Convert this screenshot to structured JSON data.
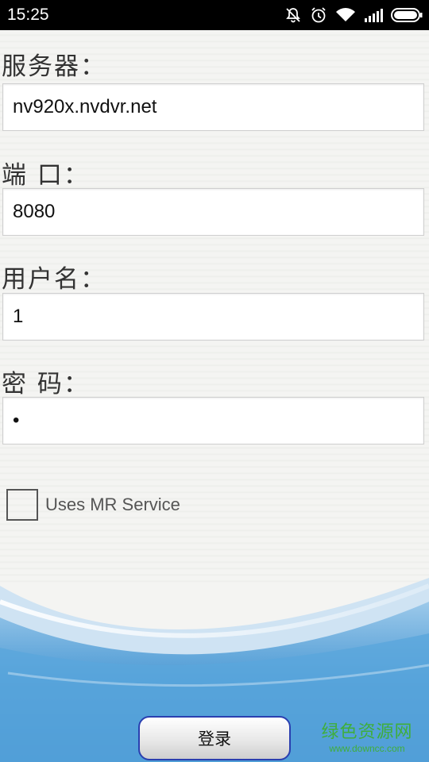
{
  "status_bar": {
    "time": "15:25",
    "icons": [
      "bell-off-icon",
      "alarm-icon",
      "wifi-icon",
      "signal-icon",
      "battery-icon"
    ]
  },
  "form": {
    "server_label": "服务器：",
    "server_value": "nv920x.nvdvr.net",
    "port_label": "端 口：",
    "port_value": "8080",
    "username_label": "用户名：",
    "username_value": "1",
    "password_label": "密 码：",
    "password_value": "•"
  },
  "options": {
    "mr_service_label": "Uses MR Service",
    "mr_service_checked": false
  },
  "actions": {
    "login_label": "登录"
  },
  "watermark": {
    "main": "绿色资源网",
    "sub": "www.downcc.com"
  },
  "colors": {
    "accent_wave": "#3d8fd0",
    "button_border": "#2a3fb0",
    "watermark": "#3fae3a"
  }
}
